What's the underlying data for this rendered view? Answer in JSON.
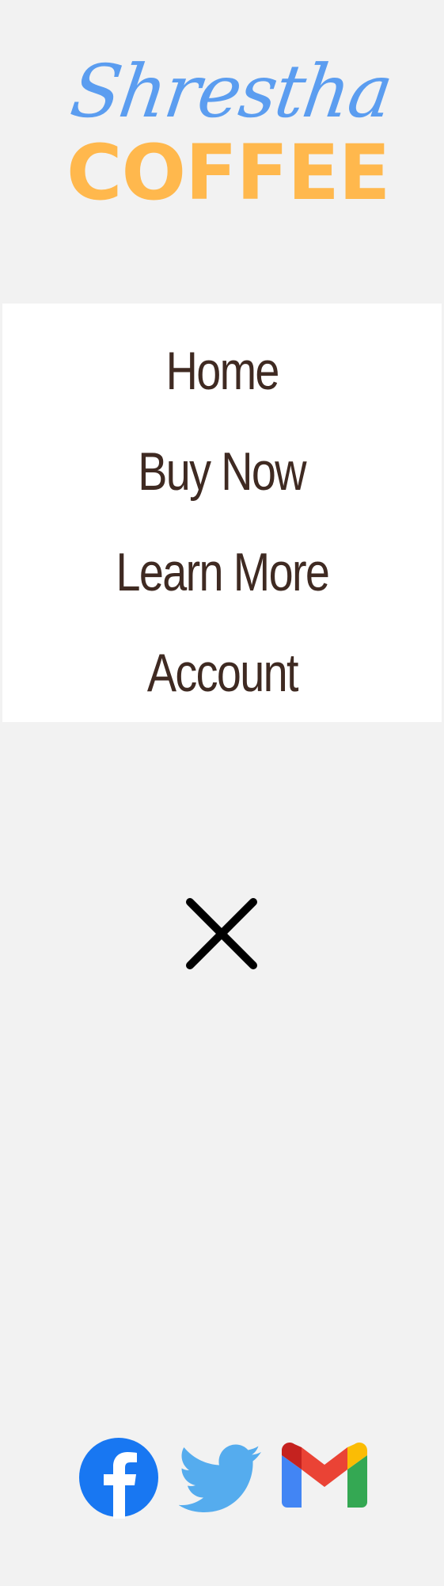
{
  "logo": {
    "script_text": "Shrestha",
    "bold_text": "COFFEE",
    "script_color": "#5b9df0",
    "bold_color": "#ffb84d"
  },
  "menu": {
    "items": [
      {
        "label": "Home"
      },
      {
        "label": "Buy Now"
      },
      {
        "label": "Learn More"
      },
      {
        "label": "Account"
      }
    ],
    "text_color": "#3f2a22",
    "background": "#ffffff"
  },
  "close": {
    "icon": "close-icon"
  },
  "social": {
    "items": [
      {
        "icon": "facebook-icon",
        "color": "#1877f2"
      },
      {
        "icon": "twitter-icon",
        "color": "#55acee"
      },
      {
        "icon": "gmail-icon",
        "colors": [
          "#4285f4",
          "#ea4335",
          "#fbbc04",
          "#34a853",
          "#c5221f"
        ]
      }
    ]
  },
  "page": {
    "background": "#f2f2f2"
  }
}
